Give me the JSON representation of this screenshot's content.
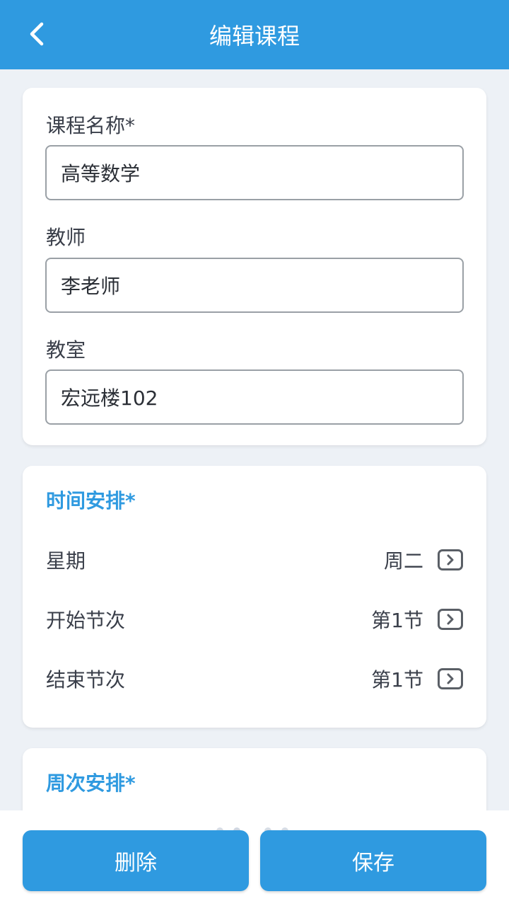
{
  "header": {
    "title": "编辑课程"
  },
  "course_form": {
    "name_label": "课程名称*",
    "name_value": "高等数学",
    "teacher_label": "教师",
    "teacher_value": "李老师",
    "room_label": "教室",
    "room_value": "宏远楼102"
  },
  "schedule": {
    "title": "时间安排*",
    "rows": [
      {
        "label": "星期",
        "value": "周二"
      },
      {
        "label": "开始节次",
        "value": "第1节"
      },
      {
        "label": "结束节次",
        "value": "第1节"
      }
    ]
  },
  "weeks": {
    "title": "周次安排*"
  },
  "actions": {
    "delete_label": "删除",
    "save_label": "保存"
  },
  "colors": {
    "accent": "#2f9ae0",
    "background": "#edf1f6"
  }
}
